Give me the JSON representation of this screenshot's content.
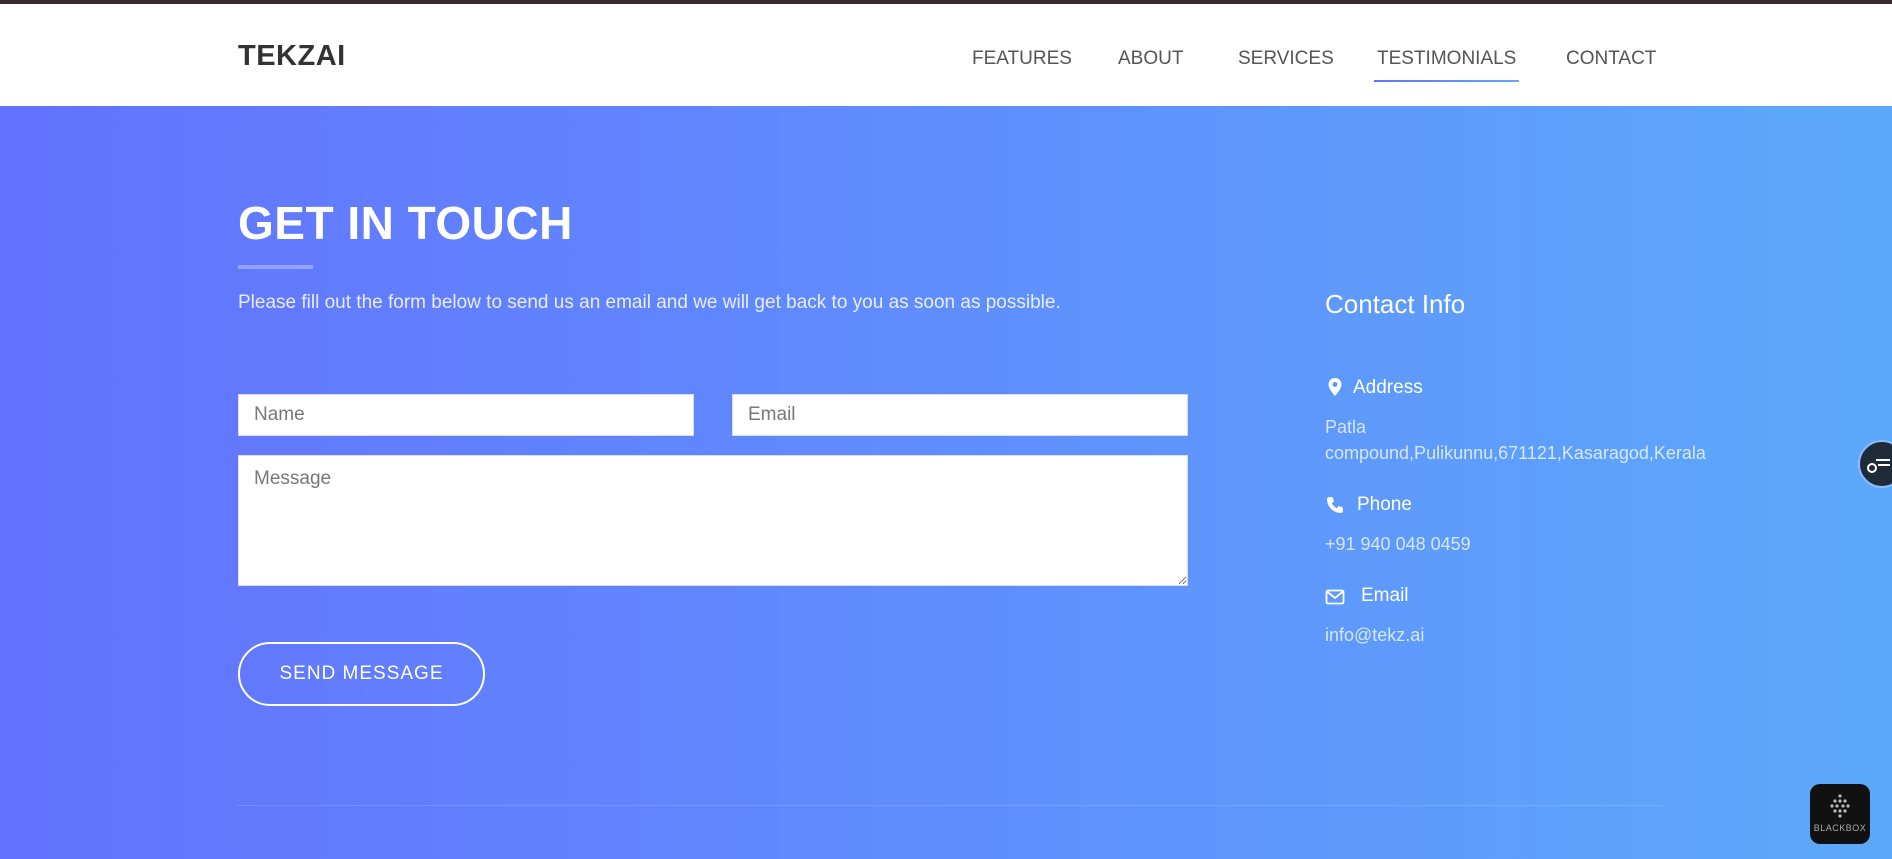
{
  "brand": "TEKZAI",
  "nav": {
    "items": [
      {
        "label": "FEATURES"
      },
      {
        "label": "ABOUT"
      },
      {
        "label": "SERVICES"
      },
      {
        "label": "TESTIMONIALS",
        "active": true
      },
      {
        "label": "CONTACT"
      }
    ]
  },
  "contact_form": {
    "title": "GET IN TOUCH",
    "description": "Please fill out the form below to send us an email and we will get back to you as soon as possible.",
    "name_placeholder": "Name",
    "email_placeholder": "Email",
    "message_placeholder": "Message",
    "submit_label": "SEND MESSAGE"
  },
  "contact_info": {
    "title": "Contact Info",
    "address_label": "Address",
    "address_line1": "Patla",
    "address_line2": "compound,Pulikunnu,671121,Kasaragod,Kerala",
    "phone_label": "Phone",
    "phone_value": "+91 940 048 0459",
    "email_label": "Email",
    "email_value": "info@tekz.ai"
  },
  "widgets": {
    "blackbox_label": "BLACKBOX"
  },
  "colors": {
    "gradient_start": "#6372ff",
    "gradient_end": "#5ca9fb",
    "nav_text": "#555555",
    "brand_text": "#333333"
  }
}
